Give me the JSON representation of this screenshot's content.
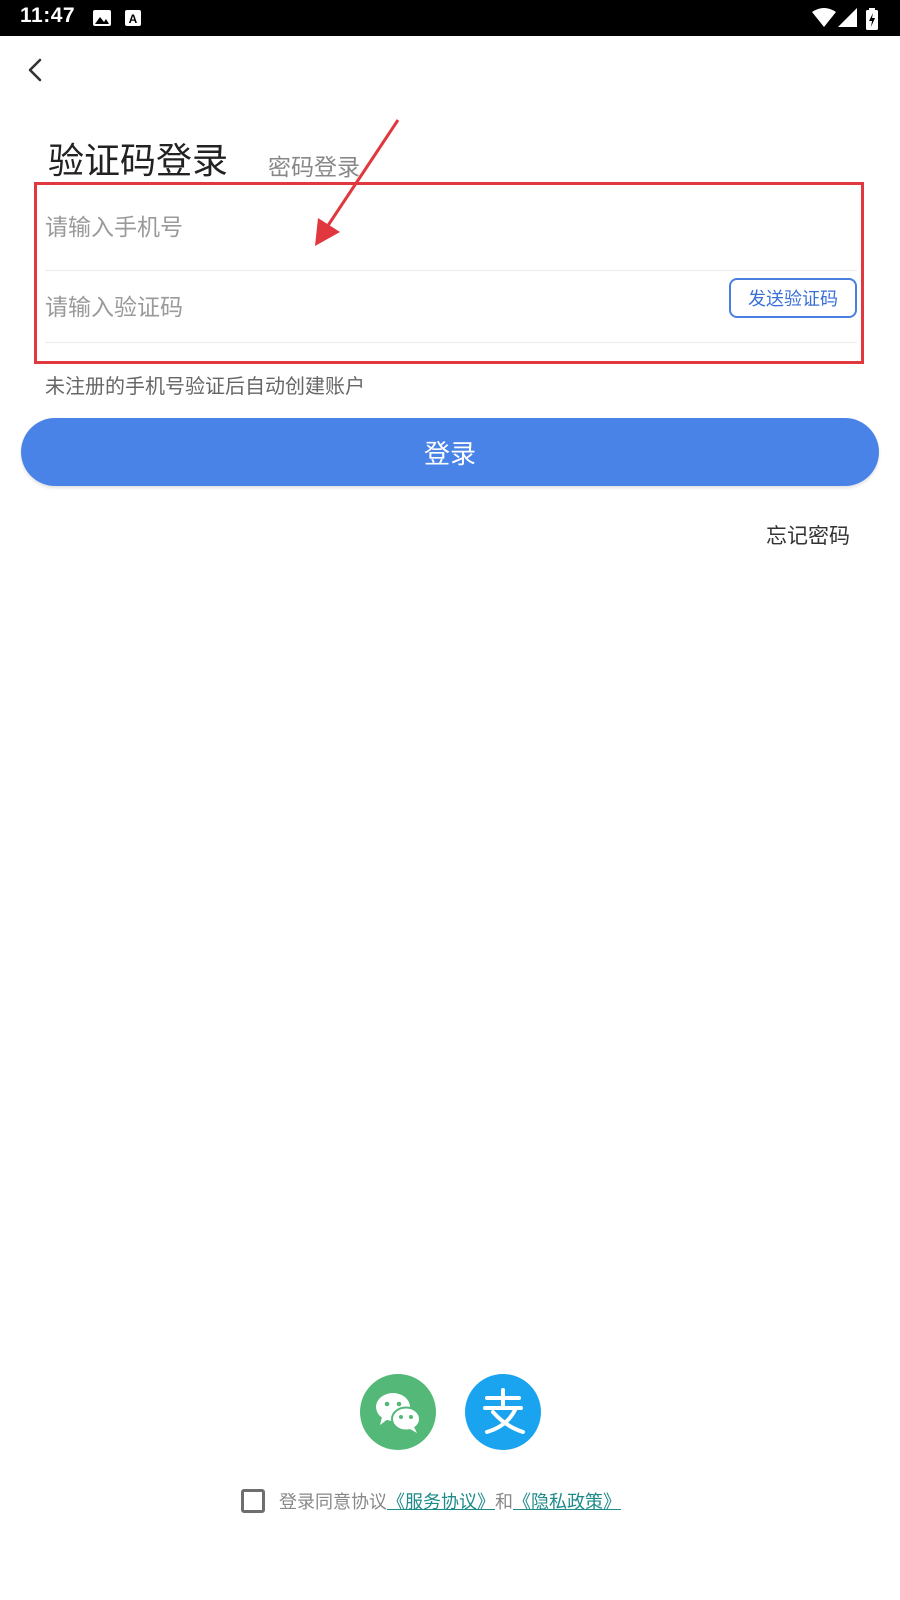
{
  "status_bar": {
    "time": "11:47",
    "icons": [
      "image-icon",
      "text-a-icon",
      "wifi-icon",
      "signal-icon",
      "battery-charging-icon"
    ]
  },
  "header": {
    "back_icon": "chevron-left-icon"
  },
  "tabs": {
    "active_label": "验证码登录",
    "inactive_label": "密码登录"
  },
  "form": {
    "phone_placeholder": "请输入手机号",
    "phone_value": "",
    "code_placeholder": "请输入验证码",
    "code_value": "",
    "send_code_label": "发送验证码",
    "hint": "未注册的手机号验证后自动创建账户"
  },
  "actions": {
    "login_label": "登录",
    "forgot_label": "忘记密码"
  },
  "social_login": {
    "items": [
      {
        "name": "wechat",
        "icon": "wechat-icon",
        "color": "#53b878"
      },
      {
        "name": "alipay",
        "icon": "alipay-icon",
        "color": "#1aa3ee"
      }
    ]
  },
  "agreement": {
    "checked": false,
    "prefix": "登录同意协议",
    "service_link": "《服务协议》",
    "conjunction": "和",
    "privacy_link": "《隐私政策》"
  },
  "colors": {
    "primary": "#4a83e8",
    "annotation": "#e0383e",
    "link": "#1f8a8a"
  }
}
